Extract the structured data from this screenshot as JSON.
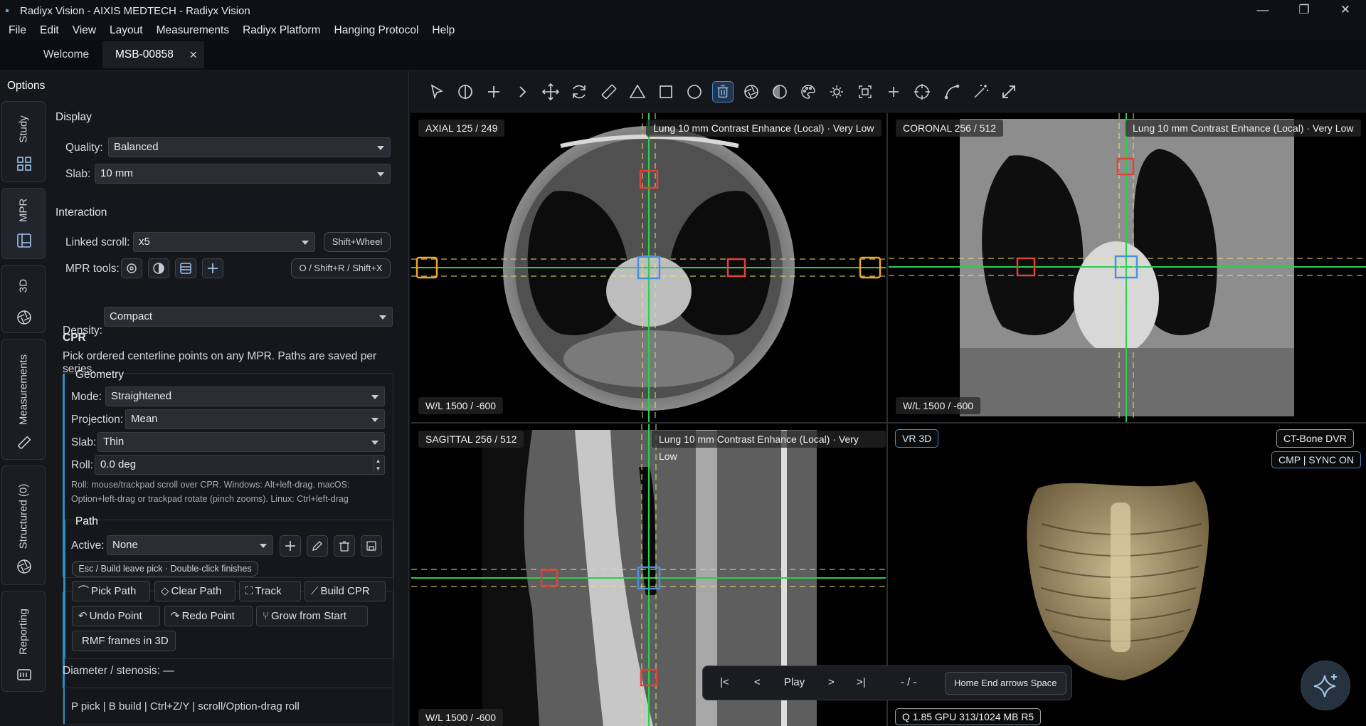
{
  "window": {
    "title": "Radiyx Vision - AIXIS MEDTECH - Radiyx Vision",
    "controls": {
      "minimize": "—",
      "restore": "❐",
      "close": "✕"
    }
  },
  "menu": [
    "File",
    "Edit",
    "View",
    "Layout",
    "Measurements",
    "Radiyx Platform",
    "Hanging Protocol",
    "Help"
  ],
  "tabs": {
    "welcome": "Welcome",
    "study": "MSB-00858",
    "close": "×"
  },
  "sidebar": {
    "title": "Options",
    "vtabs": [
      "Study",
      "MPR",
      "3D",
      "Measurements",
      "Structured (0)",
      "Reporting"
    ],
    "display": {
      "heading": "Display",
      "quality_label": "Quality:",
      "quality_value": "Balanced",
      "slab_label": "Slab:",
      "slab_value": "10 mm"
    },
    "interaction": {
      "heading": "Interaction",
      "linked_label": "Linked scroll:",
      "linked_value": "x5",
      "linked_hint": "Shift+Wheel",
      "tools_label": "MPR tools:",
      "tools_hint": "O / Shift+R / Shift+X"
    },
    "density_label": "Density:",
    "density_value": "Compact",
    "cpr": {
      "heading": "CPR",
      "desc": "Pick ordered centerline points on any MPR. Paths are saved per series.",
      "geometry": {
        "heading": "Geometry",
        "mode_label": "Mode:",
        "mode_value": "Straightened",
        "projection_label": "Projection:",
        "projection_value": "Mean",
        "slab_label": "Slab:",
        "slab_value": "Thin",
        "roll_label": "Roll:",
        "roll_value": "0.0 deg",
        "roll_help_1": "Roll: mouse/trackpad scroll over CPR. Windows: Alt+left-drag. macOS:",
        "roll_help_2": "Option+left-drag or trackpad rotate (pinch zooms). Linux: Ctrl+left-drag"
      },
      "path": {
        "heading": "Path",
        "active_label": "Active:",
        "active_value": "None",
        "hint": "Esc / Build leave pick · Double-click finishes",
        "buttons": {
          "pick": "Pick Path",
          "clear": "Clear Path",
          "track": "Track",
          "build": "Build CPR",
          "undo": "Undo Point",
          "redo": "Redo Point",
          "grow": "Grow from Start",
          "rmf": "RMF frames in 3D"
        }
      },
      "diameter": "Diameter / stenosis: —",
      "shortcuts": "P pick | B build | Ctrl+Z/Y | scroll/Option-drag roll"
    }
  },
  "viewports": {
    "axial": {
      "label": "AXIAL  125 / 249",
      "info": "Lung  10 mm  Contrast Enhance (Local) · Very Low",
      "wl": "W/L 1500 / -600"
    },
    "coronal": {
      "label": "CORONAL  256 / 512",
      "info": "Lung  10 mm  Contrast Enhance (Local) · Very Low",
      "wl": "W/L 1500 / -600"
    },
    "sagittal": {
      "label": "SAGITTAL  256 / 512",
      "info": "Lung  10 mm  Contrast Enhance (Local) · Very Low",
      "wl": "W/L 1500 / -600"
    },
    "vr": {
      "label": "VR 3D",
      "preset": "CT-Bone  DVR",
      "sync": "CMP | SYNC ON",
      "status": "Q 1.85  GPU 313/1024 MB  R5"
    }
  },
  "playbar": {
    "first": "|<",
    "prev": "<",
    "play": "Play",
    "next": ">",
    "last": ">|",
    "frame": "- / -",
    "keys": "Home End  arrows  Space"
  },
  "colors": {
    "accent": "#2d8ec0",
    "crosshair": "#27d14a",
    "marker_blue": "#4a90e2",
    "marker_red": "#e0423a",
    "marker_orange": "#f2a623",
    "dashed": "#e8e27a"
  }
}
